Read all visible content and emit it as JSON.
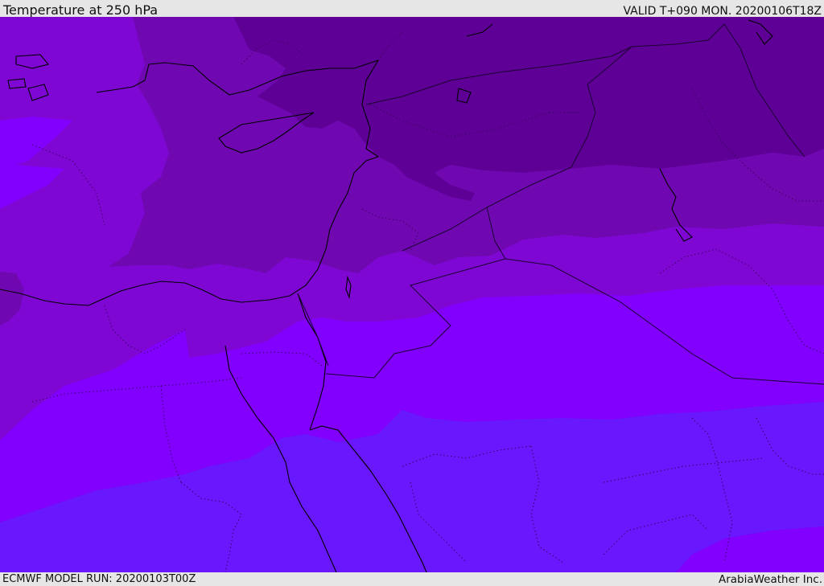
{
  "header": {
    "title": "Temperature at 250 hPa",
    "valid": "VALID T+090 MON. 20200106T18Z"
  },
  "footer": {
    "model_run": "ECMWF MODEL RUN: 20200103T00Z",
    "credit": "ArabiaWeather Inc."
  },
  "colors": {
    "band_darkest": "#5e0096",
    "band_dark": "#6f08b0",
    "band_medium": "#7e07d4",
    "band_bright": "#8100fe",
    "band_blue": "#6917fc",
    "coastline": "#000000",
    "border": "#1a0030"
  }
}
